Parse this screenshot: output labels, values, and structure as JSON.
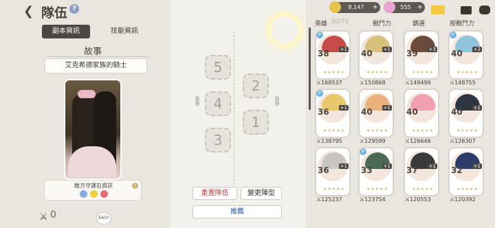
{
  "header": {
    "title": "隊伍",
    "help": "?"
  },
  "left": {
    "tabs": [
      "副本資訊",
      "技能資訊"
    ],
    "story_heading": "故事",
    "story_title": "艾克希德家族的騎士",
    "guardian_label": "敵方守護石資訊",
    "kills": "0",
    "difficulty": "EASY"
  },
  "middle": {
    "left_label": "後排",
    "right_label": "前排",
    "slots": [
      "5",
      "4",
      "3",
      "2",
      "1"
    ],
    "btn_reset": "重置隊伍",
    "btn_formation": "變更陣型",
    "btn_recommend": "推薦"
  },
  "resources": {
    "gold": "8,147",
    "gems": "555"
  },
  "filters": {
    "hero": "英雄",
    "count": "30/70",
    "power": "戰鬥力",
    "filter": "篩選",
    "sort": "按戰鬥力"
  },
  "heroes": [
    {
      "level": "38",
      "plus": "+1",
      "power": "168537",
      "color": "#c94a4a",
      "p": true
    },
    {
      "level": "40",
      "plus": "+1",
      "power": "150868",
      "color": "#d7c079",
      "p": false
    },
    {
      "level": "39",
      "plus": "+3",
      "power": "149499",
      "color": "#6a4a3a",
      "p": false
    },
    {
      "level": "40",
      "plus": "+2",
      "power": "148755",
      "color": "#8fc3d9",
      "p": true
    },
    {
      "level": "36",
      "plus": "+1",
      "power": "138795",
      "color": "#e7c86a",
      "p": true
    },
    {
      "level": "40",
      "plus": "+1",
      "power": "129599",
      "color": "#e9b27a",
      "p": false
    },
    {
      "level": "40",
      "plus": "",
      "power": "126646",
      "color": "#f0a0b0",
      "p": false
    },
    {
      "level": "40",
      "plus": "+1",
      "power": "126307",
      "color": "#2c3540",
      "p": false
    },
    {
      "level": "36",
      "plus": "+1",
      "power": "125237",
      "color": "#c9c6c2",
      "p": false
    },
    {
      "level": "33",
      "plus": "+1",
      "power": "123754",
      "color": "#4a6a55",
      "p": true
    },
    {
      "level": "37",
      "plus": "+1",
      "power": "120553",
      "color": "#3a3a3a",
      "p": false
    },
    {
      "level": "32",
      "plus": "+1",
      "power": "120392",
      "color": "#2d3d6a",
      "p": false
    }
  ]
}
